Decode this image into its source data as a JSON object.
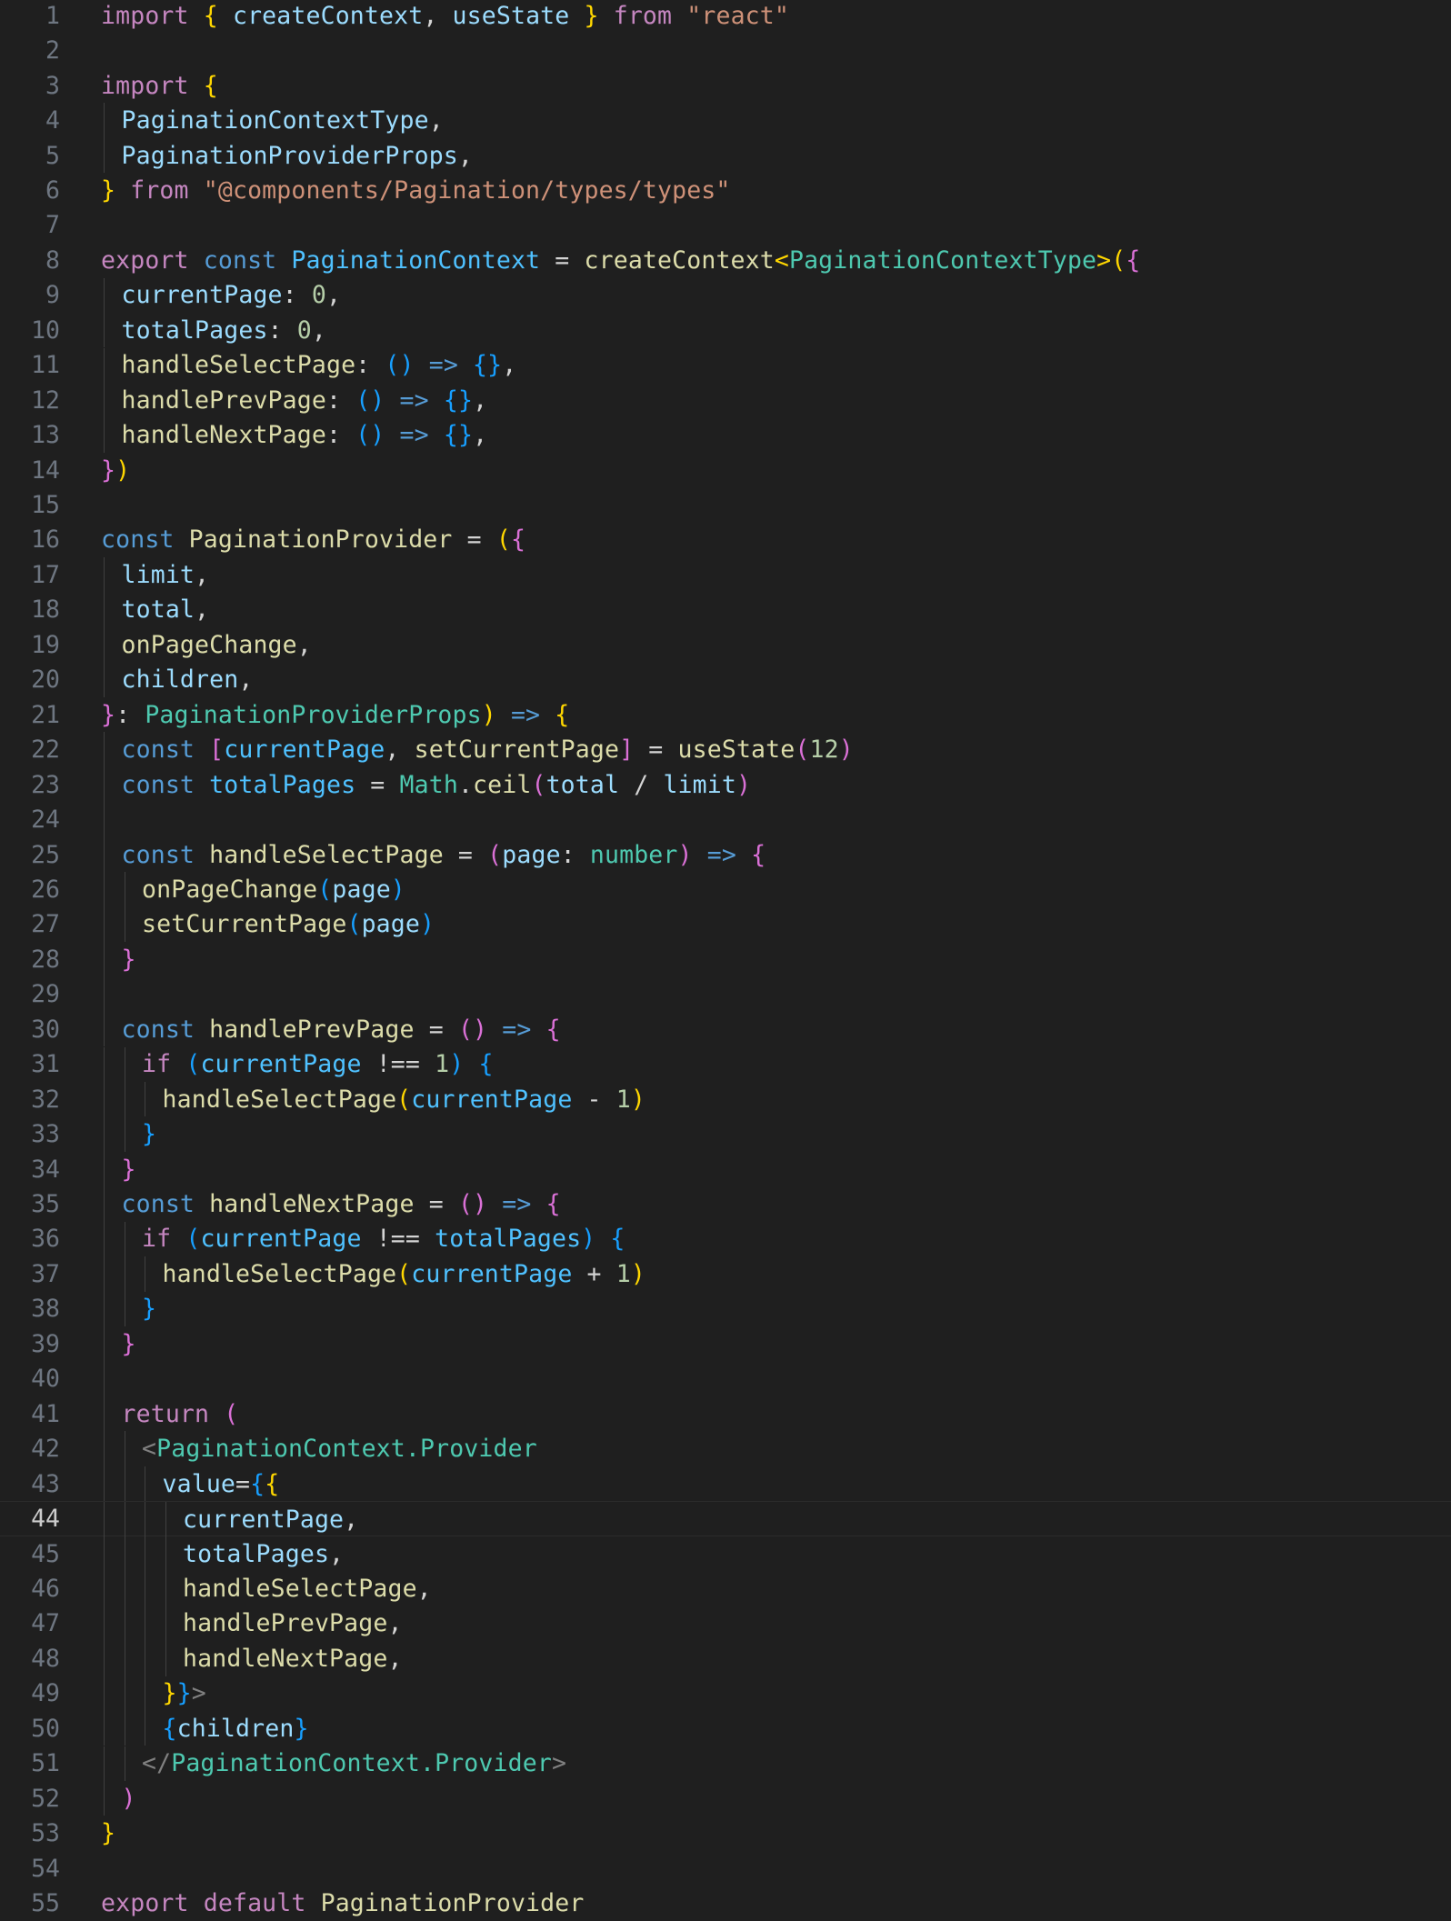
{
  "editor": {
    "colors": {
      "background": "#1f1f1f",
      "line_number": "#6e7681",
      "current_line_number": "#cccccc"
    },
    "current_line": 44,
    "lines": [
      {
        "n": "1",
        "indent": 0,
        "tokens": [
          [
            "keyword",
            "import"
          ],
          [
            "plain",
            " "
          ],
          [
            "bracket1",
            "{"
          ],
          [
            "plain",
            " "
          ],
          [
            "variable",
            "createContext"
          ],
          [
            "plain",
            ", "
          ],
          [
            "variable",
            "useState"
          ],
          [
            "plain",
            " "
          ],
          [
            "bracket1",
            "}"
          ],
          [
            "plain",
            " "
          ],
          [
            "keyword",
            "from"
          ],
          [
            "plain",
            " "
          ],
          [
            "string",
            "\"react\""
          ]
        ]
      },
      {
        "n": "2",
        "indent": 0,
        "tokens": []
      },
      {
        "n": "3",
        "indent": 0,
        "tokens": [
          [
            "keyword",
            "import"
          ],
          [
            "plain",
            " "
          ],
          [
            "bracket1",
            "{"
          ]
        ]
      },
      {
        "n": "4",
        "indent": 1,
        "tokens": [
          [
            "variable",
            "PaginationContextType"
          ],
          [
            "plain",
            ","
          ]
        ]
      },
      {
        "n": "5",
        "indent": 1,
        "tokens": [
          [
            "variable",
            "PaginationProviderProps"
          ],
          [
            "plain",
            ","
          ]
        ]
      },
      {
        "n": "6",
        "indent": 0,
        "tokens": [
          [
            "bracket1",
            "}"
          ],
          [
            "plain",
            " "
          ],
          [
            "keyword",
            "from"
          ],
          [
            "plain",
            " "
          ],
          [
            "string",
            "\"@components/Pagination/types/types\""
          ]
        ]
      },
      {
        "n": "7",
        "indent": 0,
        "tokens": []
      },
      {
        "n": "8",
        "indent": 0,
        "tokens": [
          [
            "keyword",
            "export"
          ],
          [
            "plain",
            " "
          ],
          [
            "storage",
            "const"
          ],
          [
            "plain",
            " "
          ],
          [
            "const",
            "PaginationContext"
          ],
          [
            "plain",
            " = "
          ],
          [
            "function",
            "createContext"
          ],
          [
            "bracket1",
            "<"
          ],
          [
            "type",
            "PaginationContextType"
          ],
          [
            "bracket1",
            ">"
          ],
          [
            "bracket1",
            "("
          ],
          [
            "bracket2",
            "{"
          ]
        ]
      },
      {
        "n": "9",
        "indent": 1,
        "tokens": [
          [
            "variable",
            "currentPage"
          ],
          [
            "plain",
            ": "
          ],
          [
            "number",
            "0"
          ],
          [
            "plain",
            ","
          ]
        ]
      },
      {
        "n": "10",
        "indent": 1,
        "tokens": [
          [
            "variable",
            "totalPages"
          ],
          [
            "plain",
            ": "
          ],
          [
            "number",
            "0"
          ],
          [
            "plain",
            ","
          ]
        ]
      },
      {
        "n": "11",
        "indent": 1,
        "tokens": [
          [
            "function",
            "handleSelectPage"
          ],
          [
            "plain",
            ": "
          ],
          [
            "bracket3",
            "()"
          ],
          [
            "plain",
            " "
          ],
          [
            "storage",
            "=>"
          ],
          [
            "plain",
            " "
          ],
          [
            "bracket3",
            "{}"
          ],
          [
            "plain",
            ","
          ]
        ]
      },
      {
        "n": "12",
        "indent": 1,
        "tokens": [
          [
            "function",
            "handlePrevPage"
          ],
          [
            "plain",
            ": "
          ],
          [
            "bracket3",
            "()"
          ],
          [
            "plain",
            " "
          ],
          [
            "storage",
            "=>"
          ],
          [
            "plain",
            " "
          ],
          [
            "bracket3",
            "{}"
          ],
          [
            "plain",
            ","
          ]
        ]
      },
      {
        "n": "13",
        "indent": 1,
        "tokens": [
          [
            "function",
            "handleNextPage"
          ],
          [
            "plain",
            ": "
          ],
          [
            "bracket3",
            "()"
          ],
          [
            "plain",
            " "
          ],
          [
            "storage",
            "=>"
          ],
          [
            "plain",
            " "
          ],
          [
            "bracket3",
            "{}"
          ],
          [
            "plain",
            ","
          ]
        ]
      },
      {
        "n": "14",
        "indent": 0,
        "tokens": [
          [
            "bracket2",
            "}"
          ],
          [
            "bracket1",
            ")"
          ]
        ]
      },
      {
        "n": "15",
        "indent": 0,
        "tokens": []
      },
      {
        "n": "16",
        "indent": 0,
        "tokens": [
          [
            "storage",
            "const"
          ],
          [
            "plain",
            " "
          ],
          [
            "function",
            "PaginationProvider"
          ],
          [
            "plain",
            " = "
          ],
          [
            "bracket1",
            "("
          ],
          [
            "bracket2",
            "{"
          ]
        ]
      },
      {
        "n": "17",
        "indent": 1,
        "tokens": [
          [
            "variable",
            "limit"
          ],
          [
            "plain",
            ","
          ]
        ]
      },
      {
        "n": "18",
        "indent": 1,
        "tokens": [
          [
            "variable",
            "total"
          ],
          [
            "plain",
            ","
          ]
        ]
      },
      {
        "n": "19",
        "indent": 1,
        "tokens": [
          [
            "function",
            "onPageChange"
          ],
          [
            "plain",
            ","
          ]
        ]
      },
      {
        "n": "20",
        "indent": 1,
        "tokens": [
          [
            "variable",
            "children"
          ],
          [
            "plain",
            ","
          ]
        ]
      },
      {
        "n": "21",
        "indent": 0,
        "tokens": [
          [
            "bracket2",
            "}"
          ],
          [
            "plain",
            ": "
          ],
          [
            "type",
            "PaginationProviderProps"
          ],
          [
            "bracket1",
            ")"
          ],
          [
            "plain",
            " "
          ],
          [
            "storage",
            "=>"
          ],
          [
            "plain",
            " "
          ],
          [
            "bracket1",
            "{"
          ]
        ]
      },
      {
        "n": "22",
        "indent": 1,
        "tokens": [
          [
            "storage",
            "const"
          ],
          [
            "plain",
            " "
          ],
          [
            "bracket2",
            "["
          ],
          [
            "const",
            "currentPage"
          ],
          [
            "plain",
            ", "
          ],
          [
            "function",
            "setCurrentPage"
          ],
          [
            "bracket2",
            "]"
          ],
          [
            "plain",
            " = "
          ],
          [
            "function",
            "useState"
          ],
          [
            "bracket2",
            "("
          ],
          [
            "number",
            "12"
          ],
          [
            "bracket2",
            ")"
          ]
        ]
      },
      {
        "n": "23",
        "indent": 1,
        "tokens": [
          [
            "storage",
            "const"
          ],
          [
            "plain",
            " "
          ],
          [
            "const",
            "totalPages"
          ],
          [
            "plain",
            " = "
          ],
          [
            "type",
            "Math"
          ],
          [
            "plain",
            "."
          ],
          [
            "function",
            "ceil"
          ],
          [
            "bracket2",
            "("
          ],
          [
            "variable",
            "total"
          ],
          [
            "plain",
            " / "
          ],
          [
            "variable",
            "limit"
          ],
          [
            "bracket2",
            ")"
          ]
        ]
      },
      {
        "n": "24",
        "indent": 1,
        "tokens": []
      },
      {
        "n": "25",
        "indent": 1,
        "tokens": [
          [
            "storage",
            "const"
          ],
          [
            "plain",
            " "
          ],
          [
            "function",
            "handleSelectPage"
          ],
          [
            "plain",
            " = "
          ],
          [
            "bracket2",
            "("
          ],
          [
            "variable",
            "page"
          ],
          [
            "plain",
            ": "
          ],
          [
            "type",
            "number"
          ],
          [
            "bracket2",
            ")"
          ],
          [
            "plain",
            " "
          ],
          [
            "storage",
            "=>"
          ],
          [
            "plain",
            " "
          ],
          [
            "bracket2",
            "{"
          ]
        ]
      },
      {
        "n": "26",
        "indent": 2,
        "tokens": [
          [
            "function",
            "onPageChange"
          ],
          [
            "bracket3",
            "("
          ],
          [
            "variable",
            "page"
          ],
          [
            "bracket3",
            ")"
          ]
        ]
      },
      {
        "n": "27",
        "indent": 2,
        "tokens": [
          [
            "function",
            "setCurrentPage"
          ],
          [
            "bracket3",
            "("
          ],
          [
            "variable",
            "page"
          ],
          [
            "bracket3",
            ")"
          ]
        ]
      },
      {
        "n": "28",
        "indent": 1,
        "tokens": [
          [
            "bracket2",
            "}"
          ]
        ]
      },
      {
        "n": "29",
        "indent": 1,
        "tokens": []
      },
      {
        "n": "30",
        "indent": 1,
        "tokens": [
          [
            "storage",
            "const"
          ],
          [
            "plain",
            " "
          ],
          [
            "function",
            "handlePrevPage"
          ],
          [
            "plain",
            " = "
          ],
          [
            "bracket2",
            "()"
          ],
          [
            "plain",
            " "
          ],
          [
            "storage",
            "=>"
          ],
          [
            "plain",
            " "
          ],
          [
            "bracket2",
            "{"
          ]
        ]
      },
      {
        "n": "31",
        "indent": 2,
        "tokens": [
          [
            "keyword",
            "if"
          ],
          [
            "plain",
            " "
          ],
          [
            "bracket3",
            "("
          ],
          [
            "const",
            "currentPage"
          ],
          [
            "plain",
            " !== "
          ],
          [
            "number",
            "1"
          ],
          [
            "bracket3",
            ")"
          ],
          [
            "plain",
            " "
          ],
          [
            "bracket3",
            "{"
          ]
        ]
      },
      {
        "n": "32",
        "indent": 3,
        "tokens": [
          [
            "function",
            "handleSelectPage"
          ],
          [
            "bracket1",
            "("
          ],
          [
            "const",
            "currentPage"
          ],
          [
            "plain",
            " - "
          ],
          [
            "number",
            "1"
          ],
          [
            "bracket1",
            ")"
          ]
        ]
      },
      {
        "n": "33",
        "indent": 2,
        "tokens": [
          [
            "bracket3",
            "}"
          ]
        ]
      },
      {
        "n": "34",
        "indent": 1,
        "tokens": [
          [
            "bracket2",
            "}"
          ]
        ]
      },
      {
        "n": "35",
        "indent": 1,
        "tokens": [
          [
            "storage",
            "const"
          ],
          [
            "plain",
            " "
          ],
          [
            "function",
            "handleNextPage"
          ],
          [
            "plain",
            " = "
          ],
          [
            "bracket2",
            "()"
          ],
          [
            "plain",
            " "
          ],
          [
            "storage",
            "=>"
          ],
          [
            "plain",
            " "
          ],
          [
            "bracket2",
            "{"
          ]
        ]
      },
      {
        "n": "36",
        "indent": 2,
        "tokens": [
          [
            "keyword",
            "if"
          ],
          [
            "plain",
            " "
          ],
          [
            "bracket3",
            "("
          ],
          [
            "const",
            "currentPage"
          ],
          [
            "plain",
            " !== "
          ],
          [
            "const",
            "totalPages"
          ],
          [
            "bracket3",
            ")"
          ],
          [
            "plain",
            " "
          ],
          [
            "bracket3",
            "{"
          ]
        ]
      },
      {
        "n": "37",
        "indent": 3,
        "tokens": [
          [
            "function",
            "handleSelectPage"
          ],
          [
            "bracket1",
            "("
          ],
          [
            "const",
            "currentPage"
          ],
          [
            "plain",
            " + "
          ],
          [
            "number",
            "1"
          ],
          [
            "bracket1",
            ")"
          ]
        ]
      },
      {
        "n": "38",
        "indent": 2,
        "tokens": [
          [
            "bracket3",
            "}"
          ]
        ]
      },
      {
        "n": "39",
        "indent": 1,
        "tokens": [
          [
            "bracket2",
            "}"
          ]
        ]
      },
      {
        "n": "40",
        "indent": 1,
        "tokens": []
      },
      {
        "n": "41",
        "indent": 1,
        "tokens": [
          [
            "keyword",
            "return"
          ],
          [
            "plain",
            " "
          ],
          [
            "bracket2",
            "("
          ]
        ]
      },
      {
        "n": "42",
        "indent": 2,
        "tokens": [
          [
            "tag",
            "<"
          ],
          [
            "type",
            "PaginationContext.Provider"
          ]
        ]
      },
      {
        "n": "43",
        "indent": 3,
        "tokens": [
          [
            "attr",
            "value"
          ],
          [
            "plain",
            "="
          ],
          [
            "bracket3",
            "{"
          ],
          [
            "bracket1",
            "{"
          ]
        ]
      },
      {
        "n": "44",
        "indent": 4,
        "tokens": [
          [
            "variable",
            "currentPage"
          ],
          [
            "plain",
            ","
          ]
        ]
      },
      {
        "n": "45",
        "indent": 4,
        "tokens": [
          [
            "variable",
            "totalPages"
          ],
          [
            "plain",
            ","
          ]
        ]
      },
      {
        "n": "46",
        "indent": 4,
        "tokens": [
          [
            "function",
            "handleSelectPage"
          ],
          [
            "plain",
            ","
          ]
        ]
      },
      {
        "n": "47",
        "indent": 4,
        "tokens": [
          [
            "function",
            "handlePrevPage"
          ],
          [
            "plain",
            ","
          ]
        ]
      },
      {
        "n": "48",
        "indent": 4,
        "tokens": [
          [
            "function",
            "handleNextPage"
          ],
          [
            "plain",
            ","
          ]
        ]
      },
      {
        "n": "49",
        "indent": 3,
        "tokens": [
          [
            "bracket1",
            "}"
          ],
          [
            "bracket3",
            "}"
          ],
          [
            "tag",
            ">"
          ]
        ]
      },
      {
        "n": "50",
        "indent": 3,
        "tokens": [
          [
            "bracket3",
            "{"
          ],
          [
            "variable",
            "children"
          ],
          [
            "bracket3",
            "}"
          ]
        ]
      },
      {
        "n": "51",
        "indent": 2,
        "tokens": [
          [
            "tag",
            "</"
          ],
          [
            "type",
            "PaginationContext.Provider"
          ],
          [
            "tag",
            ">"
          ]
        ]
      },
      {
        "n": "52",
        "indent": 1,
        "tokens": [
          [
            "bracket2",
            ")"
          ]
        ]
      },
      {
        "n": "53",
        "indent": 0,
        "tokens": [
          [
            "bracket1",
            "}"
          ]
        ]
      },
      {
        "n": "54",
        "indent": 0,
        "tokens": []
      },
      {
        "n": "55",
        "indent": 0,
        "tokens": [
          [
            "keyword",
            "export"
          ],
          [
            "plain",
            " "
          ],
          [
            "keyword",
            "default"
          ],
          [
            "plain",
            " "
          ],
          [
            "function",
            "PaginationProvider"
          ]
        ]
      }
    ]
  }
}
